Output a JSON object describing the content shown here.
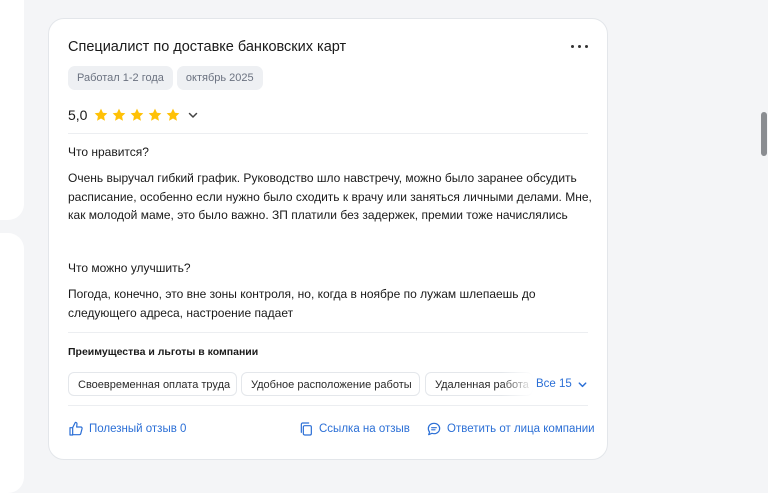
{
  "review": {
    "title": "Специалист по доставке банковских карт",
    "tags": [
      "Работал 1-2 года",
      "октябрь 2025"
    ],
    "rating_value": "5,0",
    "stars": 5,
    "likes": {
      "title": "Что нравится?",
      "text": "Очень выручал гибкий график. Руководство шло навстречу, можно было заранее обсудить расписание, особенно если нужно было сходить к врачу или заняться личными делами. Мне, как молодой маме, это было важно. ЗП платили без задержек, премии тоже начислялись"
    },
    "improve": {
      "title": "Что можно улучшить?",
      "text": "Погода, конечно, это вне зоны контроля, но, когда в ноябре по лужам шлепаешь до следующего адреса, настроение падает"
    },
    "benefits": {
      "title": "Преимущества и льготы в компании",
      "items": [
        "Своевременная оплата труда",
        "Удобное расположение работы",
        "Удаленная работа"
      ],
      "all_label": "Все 15"
    },
    "actions": {
      "useful": "Полезный отзыв 0",
      "link": "Ссылка на отзыв",
      "reply": "Ответить от лица компании"
    }
  },
  "colors": {
    "accent": "#2b6fd6",
    "star": "#ffc107",
    "chip_bg": "#eef0f3"
  }
}
